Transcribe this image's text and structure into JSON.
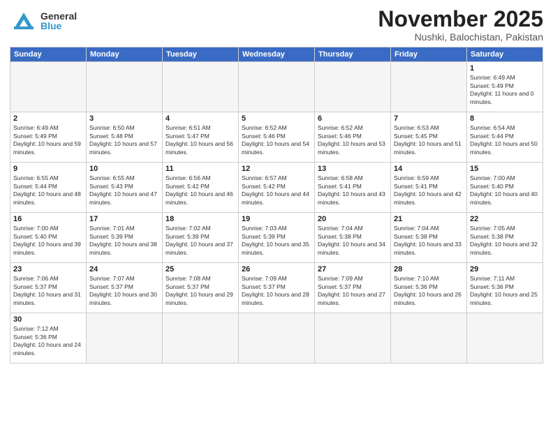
{
  "header": {
    "logo_general": "General",
    "logo_blue": "Blue",
    "month": "November 2025",
    "location": "Nushki, Balochistan, Pakistan"
  },
  "days_of_week": [
    "Sunday",
    "Monday",
    "Tuesday",
    "Wednesday",
    "Thursday",
    "Friday",
    "Saturday"
  ],
  "weeks": [
    [
      {
        "day": "",
        "empty": true
      },
      {
        "day": "",
        "empty": true
      },
      {
        "day": "",
        "empty": true
      },
      {
        "day": "",
        "empty": true
      },
      {
        "day": "",
        "empty": true
      },
      {
        "day": "",
        "empty": true
      },
      {
        "day": "1",
        "sunrise": "6:49 AM",
        "sunset": "5:49 PM",
        "daylight": "11 hours and 0 minutes."
      }
    ],
    [
      {
        "day": "2",
        "sunrise": "6:49 AM",
        "sunset": "5:49 PM",
        "daylight": "10 hours and 59 minutes."
      },
      {
        "day": "3",
        "sunrise": "6:50 AM",
        "sunset": "5:48 PM",
        "daylight": "10 hours and 57 minutes."
      },
      {
        "day": "4",
        "sunrise": "6:51 AM",
        "sunset": "5:47 PM",
        "daylight": "10 hours and 56 minutes."
      },
      {
        "day": "5",
        "sunrise": "6:52 AM",
        "sunset": "5:46 PM",
        "daylight": "10 hours and 54 minutes."
      },
      {
        "day": "6",
        "sunrise": "6:52 AM",
        "sunset": "5:46 PM",
        "daylight": "10 hours and 53 minutes."
      },
      {
        "day": "7",
        "sunrise": "6:53 AM",
        "sunset": "5:45 PM",
        "daylight": "10 hours and 51 minutes."
      },
      {
        "day": "8",
        "sunrise": "6:54 AM",
        "sunset": "5:44 PM",
        "daylight": "10 hours and 50 minutes."
      }
    ],
    [
      {
        "day": "9",
        "sunrise": "6:55 AM",
        "sunset": "5:44 PM",
        "daylight": "10 hours and 48 minutes."
      },
      {
        "day": "10",
        "sunrise": "6:55 AM",
        "sunset": "5:43 PM",
        "daylight": "10 hours and 47 minutes."
      },
      {
        "day": "11",
        "sunrise": "6:56 AM",
        "sunset": "5:42 PM",
        "daylight": "10 hours and 46 minutes."
      },
      {
        "day": "12",
        "sunrise": "6:57 AM",
        "sunset": "5:42 PM",
        "daylight": "10 hours and 44 minutes."
      },
      {
        "day": "13",
        "sunrise": "6:58 AM",
        "sunset": "5:41 PM",
        "daylight": "10 hours and 43 minutes."
      },
      {
        "day": "14",
        "sunrise": "6:59 AM",
        "sunset": "5:41 PM",
        "daylight": "10 hours and 42 minutes."
      },
      {
        "day": "15",
        "sunrise": "7:00 AM",
        "sunset": "5:40 PM",
        "daylight": "10 hours and 40 minutes."
      }
    ],
    [
      {
        "day": "16",
        "sunrise": "7:00 AM",
        "sunset": "5:40 PM",
        "daylight": "10 hours and 39 minutes."
      },
      {
        "day": "17",
        "sunrise": "7:01 AM",
        "sunset": "5:39 PM",
        "daylight": "10 hours and 38 minutes."
      },
      {
        "day": "18",
        "sunrise": "7:02 AM",
        "sunset": "5:39 PM",
        "daylight": "10 hours and 37 minutes."
      },
      {
        "day": "19",
        "sunrise": "7:03 AM",
        "sunset": "5:39 PM",
        "daylight": "10 hours and 35 minutes."
      },
      {
        "day": "20",
        "sunrise": "7:04 AM",
        "sunset": "5:38 PM",
        "daylight": "10 hours and 34 minutes."
      },
      {
        "day": "21",
        "sunrise": "7:04 AM",
        "sunset": "5:38 PM",
        "daylight": "10 hours and 33 minutes."
      },
      {
        "day": "22",
        "sunrise": "7:05 AM",
        "sunset": "5:38 PM",
        "daylight": "10 hours and 32 minutes."
      }
    ],
    [
      {
        "day": "23",
        "sunrise": "7:06 AM",
        "sunset": "5:37 PM",
        "daylight": "10 hours and 31 minutes."
      },
      {
        "day": "24",
        "sunrise": "7:07 AM",
        "sunset": "5:37 PM",
        "daylight": "10 hours and 30 minutes."
      },
      {
        "day": "25",
        "sunrise": "7:08 AM",
        "sunset": "5:37 PM",
        "daylight": "10 hours and 29 minutes."
      },
      {
        "day": "26",
        "sunrise": "7:09 AM",
        "sunset": "5:37 PM",
        "daylight": "10 hours and 28 minutes."
      },
      {
        "day": "27",
        "sunrise": "7:09 AM",
        "sunset": "5:37 PM",
        "daylight": "10 hours and 27 minutes."
      },
      {
        "day": "28",
        "sunrise": "7:10 AM",
        "sunset": "5:36 PM",
        "daylight": "10 hours and 26 minutes."
      },
      {
        "day": "29",
        "sunrise": "7:11 AM",
        "sunset": "5:36 PM",
        "daylight": "10 hours and 25 minutes."
      }
    ],
    [
      {
        "day": "30",
        "sunrise": "7:12 AM",
        "sunset": "5:36 PM",
        "daylight": "10 hours and 24 minutes."
      },
      {
        "day": "",
        "empty": true
      },
      {
        "day": "",
        "empty": true
      },
      {
        "day": "",
        "empty": true
      },
      {
        "day": "",
        "empty": true
      },
      {
        "day": "",
        "empty": true
      },
      {
        "day": "",
        "empty": true
      }
    ]
  ],
  "labels": {
    "sunrise": "Sunrise:",
    "sunset": "Sunset:",
    "daylight": "Daylight:"
  }
}
